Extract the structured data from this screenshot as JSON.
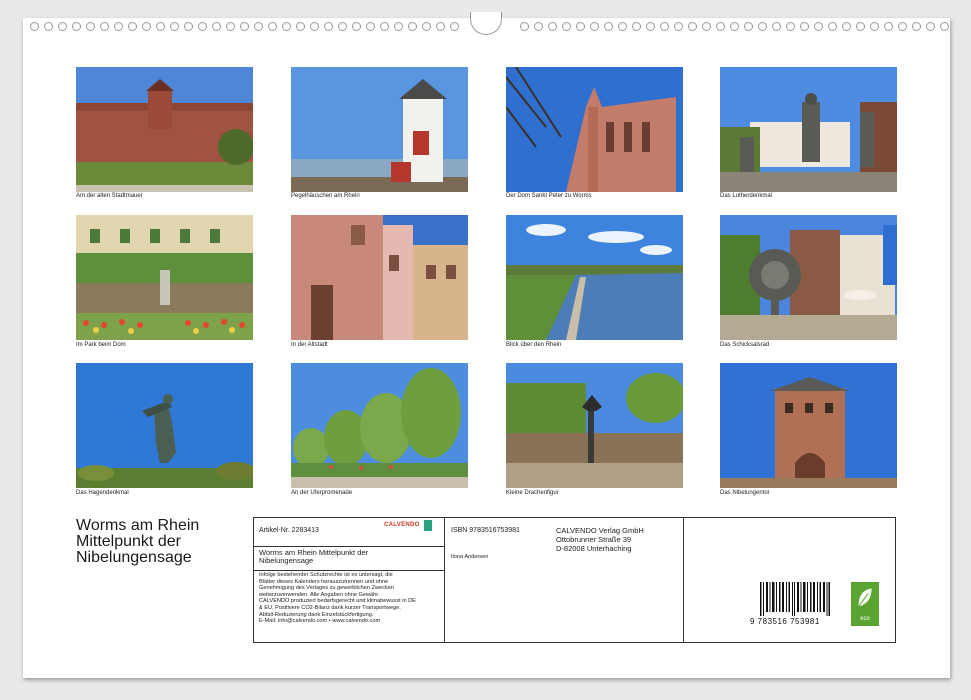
{
  "photos": [
    {
      "caption": "Am der alten Stadtmauer"
    },
    {
      "caption": "Pegelhäuschen am Rhein"
    },
    {
      "caption": "Der Dom Sankt Peter zu Worms"
    },
    {
      "caption": "Das Lutherdenkmal"
    },
    {
      "caption": "Im Park beim Dom"
    },
    {
      "caption": "In der Altstadt"
    },
    {
      "caption": "Blick über den Rhein"
    },
    {
      "caption": "Das Schicksalsrad"
    },
    {
      "caption": "Das Hagendenkmal"
    },
    {
      "caption": "An der Uferpromenade"
    },
    {
      "caption": "Kleine Drachenfigur"
    },
    {
      "caption": "Das Nibelungentor"
    }
  ],
  "title": {
    "line1": "Worms am Rhein",
    "line2": "Mittelpunkt der",
    "line3": "Nibelungensage"
  },
  "info": {
    "article": "Artikel-Nr. 2283413",
    "logo_text": "CALVENDO",
    "subtitle_line1": "Worms am Rhein Mittelpunkt der",
    "subtitle_line2": "Nibelungensage",
    "legal_lines": [
      "Infolge bestehender Schutzrechte ist es untersagt, die",
      "Blätter dieses Kalenders herauszutrennen und ohne",
      "Genehmigung des Verlages zu gewerblichen Zwecken",
      "weiterzuverwenden. Alle Angaben ohne Gewähr.",
      "CALVENDO produziert bedarfsgerecht und klimabewusst in DE",
      "& EU. Positivere CO2-Bilanz dank kurzer Transportwege.",
      "Abfall-Reduzierung dank Einzelstückfertigung.",
      "E-Mail: info@calvendo.com • www.calvendo.com"
    ],
    "isbn": "ISBN 9783516753981",
    "author": "Ilona Andersen",
    "publisher_line1": "CALVENDO Verlag GmbH",
    "publisher_line2": "Ottobrunner Straße 39",
    "publisher_line3": "D-82008 Unterhaching",
    "barcode_number": "9 783516 753981",
    "eco_label": "eco"
  },
  "colors": {
    "sky": "#3f7fd6",
    "panel_border": "#333333",
    "eco_green": "#5aa531"
  }
}
